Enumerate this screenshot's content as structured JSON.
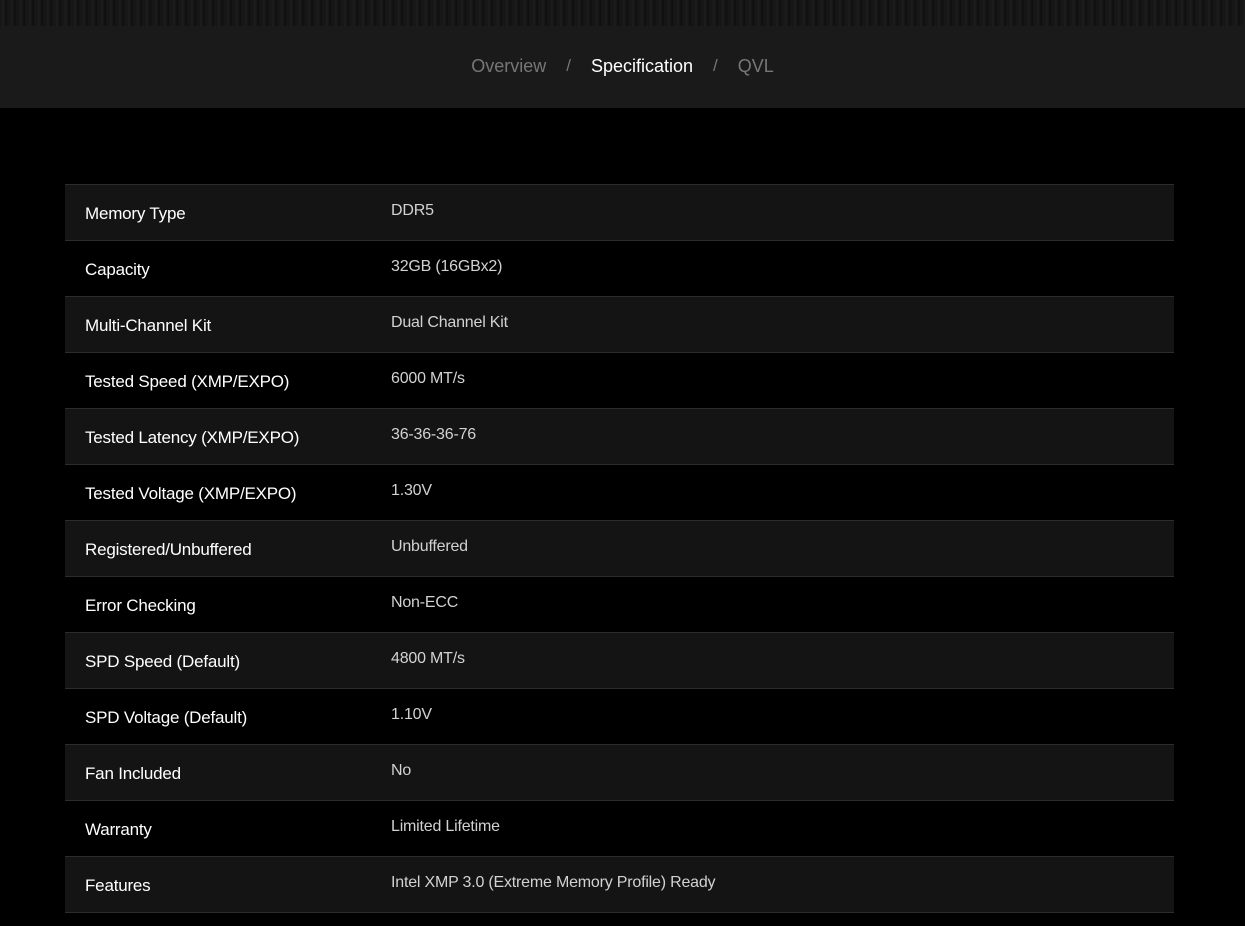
{
  "nav": {
    "tabs": [
      {
        "label": "Overview",
        "active": false
      },
      {
        "label": "Specification",
        "active": true
      },
      {
        "label": "QVL",
        "active": false
      }
    ],
    "separator": "/"
  },
  "specs": [
    {
      "label": "Memory Type",
      "value": "DDR5"
    },
    {
      "label": "Capacity",
      "value": "32GB (16GBx2)"
    },
    {
      "label": "Multi-Channel Kit",
      "value": "Dual Channel Kit"
    },
    {
      "label": "Tested Speed (XMP/EXPO)",
      "value": "6000 MT/s"
    },
    {
      "label": "Tested Latency (XMP/EXPO)",
      "value": "36-36-36-76"
    },
    {
      "label": "Tested Voltage (XMP/EXPO)",
      "value": "1.30V"
    },
    {
      "label": "Registered/Unbuffered",
      "value": "Unbuffered"
    },
    {
      "label": "Error Checking",
      "value": "Non-ECC"
    },
    {
      "label": "SPD Speed (Default)",
      "value": "4800 MT/s"
    },
    {
      "label": "SPD Voltage (Default)",
      "value": "1.10V"
    },
    {
      "label": "Fan Included",
      "value": "No"
    },
    {
      "label": "Warranty",
      "value": "Limited Lifetime"
    },
    {
      "label": "Features",
      "value": "Intel XMP 3.0 (Extreme Memory Profile) Ready"
    }
  ],
  "colors": {
    "background": "#000000",
    "nav_background": "#1a1a1a",
    "row_alt": "#141414",
    "active_tab": "#ffffff",
    "inactive_tab": "#777777"
  }
}
